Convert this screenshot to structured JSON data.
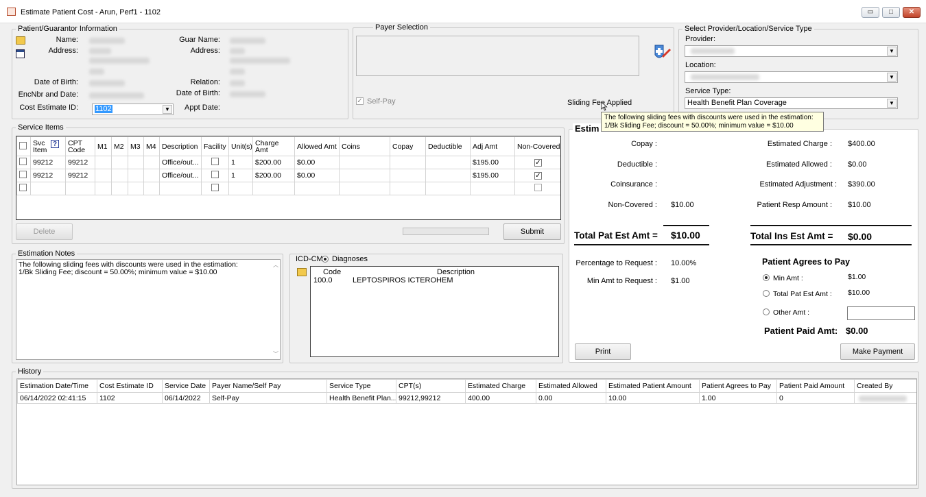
{
  "window": {
    "title": "Estimate Patient Cost - Arun, Perf1 - 1102",
    "minimize": "▭",
    "maximize": "□",
    "close": "✕"
  },
  "patient": {
    "legend": "Patient/Guarantor Information",
    "name_label": "Name:",
    "address_label": "Address:",
    "dob_label": "Date of Birth:",
    "enc_label": "EncNbr and Date:",
    "cost_id_label": "Cost Estimate ID:",
    "cost_id_value": "1102",
    "guar_name_label": "Guar Name:",
    "guar_address_label": "Address:",
    "relation_label": "Relation:",
    "guar_dob_label": "Date of Birth:",
    "appt_label": "Appt Date:"
  },
  "payer": {
    "legend": "Payer Selection",
    "self_pay_label": "Self-Pay",
    "sliding_fee_label": "Sliding Fee Applied"
  },
  "provider": {
    "legend": "Select Provider/Location/Service Type",
    "provider_label": "Provider:",
    "location_label": "Location:",
    "service_type_label": "Service Type:",
    "service_type_value": "Health Benefit Plan Coverage"
  },
  "tooltip": {
    "line1": "The following sliding fees with discounts were used in the estimation:",
    "line2": "1/Bk Sliding Fee; discount =  50.00%; minimum value =  $10.00"
  },
  "service_items": {
    "legend": "Service Items",
    "headers": [
      "",
      "Svc Item",
      "CPT Code",
      "M1",
      "M2",
      "M3",
      "M4",
      "Description",
      "Facility",
      "Unit(s)",
      "Charge Amt",
      "Allowed Amt",
      "Coins",
      "Copay",
      "Deductible",
      "Adj Amt",
      "Non-Covered"
    ],
    "rows": [
      {
        "svc": "99212",
        "cpt": "99212",
        "desc": "Office/out...",
        "units": "1",
        "charge": "$200.00",
        "allowed": "$0.00",
        "adj": "$195.00",
        "noncovered": "✓"
      },
      {
        "svc": "99212",
        "cpt": "99212",
        "desc": "Office/out...",
        "units": "1",
        "charge": "$200.00",
        "allowed": "$0.00",
        "adj": "$195.00",
        "noncovered": "✓"
      }
    ],
    "delete_label": "Delete",
    "submit_label": "Submit"
  },
  "notes": {
    "legend": "Estimation Notes",
    "line1": "The following sliding fees with discounts were used in the estimation:",
    "line2": "1/Bk Sliding Fee; discount =  50.00%; minimum value =  $10.00"
  },
  "icd": {
    "legend": "ICD-CM",
    "diagnoses_label": "Diagnoses",
    "code_header": "Code",
    "desc_header": "Description",
    "code": "100.0",
    "description": "LEPTOSPIROS ICTEROHEM"
  },
  "estimate": {
    "legend": "Estim",
    "copay_label": "Copay :",
    "deductible_label": "Deductible :",
    "coinsurance_label": "Coinsurance :",
    "noncovered_label": "Non-Covered :",
    "noncovered_value": "$10.00",
    "est_charge_label": "Estimated Charge :",
    "est_charge_value": "$400.00",
    "est_allowed_label": "Estimated Allowed :",
    "est_allowed_value": "$0.00",
    "est_adj_label": "Estimated Adjustment :",
    "est_adj_value": "$390.00",
    "pat_resp_label": "Patient Resp Amount :",
    "pat_resp_value": "$10.00",
    "total_pat_label": "Total Pat Est Amt =",
    "total_pat_value": "$10.00",
    "total_ins_label": "Total Ins Est Amt =",
    "total_ins_value": "$0.00",
    "pct_label": "Percentage to Request :",
    "pct_value": "10.00%",
    "min_amt_label": "Min Amt to Request :",
    "min_amt_value": "$1.00",
    "agrees_title": "Patient Agrees to Pay",
    "opt_min_label": "Min Amt :",
    "opt_min_value": "$1.00",
    "opt_total_label": "Total Pat Est Amt :",
    "opt_total_value": "$10.00",
    "opt_other_label": "Other Amt :",
    "paid_label": "Patient Paid Amt:",
    "paid_value": "$0.00",
    "print_label": "Print",
    "payment_label": "Make Payment"
  },
  "history": {
    "legend": "History",
    "headers": [
      "Estimation Date/Time",
      "Cost Estimate ID",
      "Service Date",
      "Payer Name/Self Pay",
      "Service Type",
      "CPT(s)",
      "Estimated Charge",
      "Estimated Allowed",
      "Estimated Patient Amount",
      "Patient Agrees to Pay",
      "Patient Paid Amount",
      "Created By"
    ],
    "row": [
      "06/14/2022 02:41:15",
      "1102",
      "06/14/2022",
      "Self-Pay",
      "Health Benefit Plan...",
      "99212,99212",
      "400.00",
      "0.00",
      "10.00",
      "1.00",
      "0",
      ""
    ]
  }
}
